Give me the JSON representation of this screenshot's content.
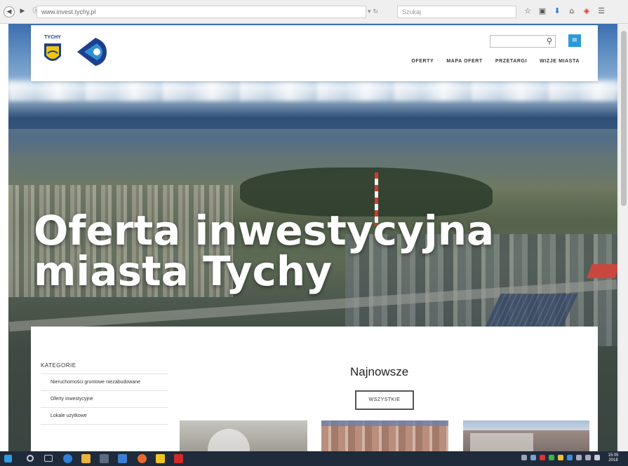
{
  "browser": {
    "back_icon": "back-arrow-icon",
    "url": "www.invest.tychy.pl",
    "search_placeholder": "Szukaj",
    "toolbar_icons": [
      "star-icon",
      "reader-icon",
      "download-icon",
      "home-icon",
      "pocket-icon",
      "menu-icon"
    ]
  },
  "header": {
    "logo_text": "TYCHY",
    "search_icon": "search-icon",
    "lang_icon": "language-icon",
    "nav": [
      "OFERTY",
      "MAPA OFERT",
      "PRZETARGI",
      "WIZJE MIASTA"
    ]
  },
  "hero": {
    "title_line1": "Oferta inwestycyjna",
    "title_line2": "miasta Tychy"
  },
  "sidebar": {
    "heading": "KATEGORIE",
    "items": [
      "Nieruchomości gruntowe niezabudowane",
      "Oferty inwestycyjne",
      "Lokale użytkowe"
    ]
  },
  "main": {
    "newest_title": "Najnowsze",
    "all_button": "WSZYSTKIE"
  },
  "taskbar": {
    "clock_time": "15:05",
    "clock_date": "2018"
  },
  "colors": {
    "accent": "#2e9ad8",
    "nav_text": "#333333",
    "taskbar": "#1f2a3a"
  }
}
